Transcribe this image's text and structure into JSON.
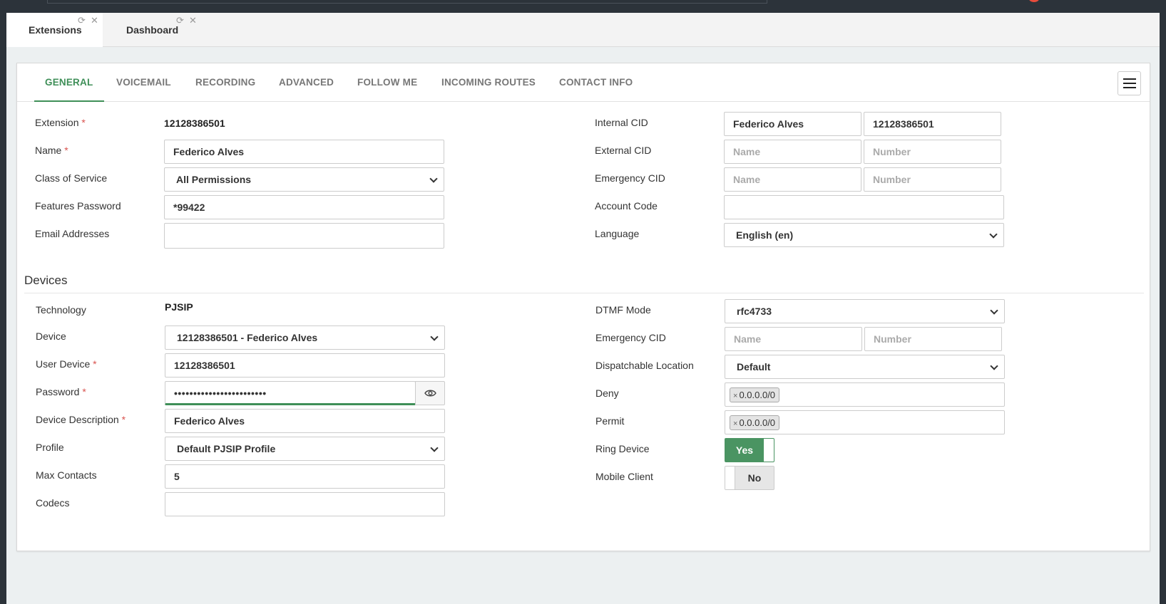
{
  "page_tabs": [
    {
      "label": "Extensions"
    },
    {
      "label": "Dashboard"
    }
  ],
  "sub_tabs": [
    "GENERAL",
    "VOICEMAIL",
    "RECORDING",
    "ADVANCED",
    "FOLLOW ME",
    "INCOMING ROUTES",
    "CONTACT INFO"
  ],
  "general": {
    "extension": {
      "label": "Extension",
      "value": "12128386501"
    },
    "name": {
      "label": "Name",
      "value": "Federico Alves"
    },
    "class_of_service": {
      "label": "Class of Service",
      "value": "All Permissions"
    },
    "features_password": {
      "label": "Features Password",
      "value": "*99422"
    },
    "email_addresses": {
      "label": "Email Addresses",
      "value": ""
    },
    "internal_cid": {
      "label": "Internal CID",
      "name": "Federico Alves",
      "number": "12128386501"
    },
    "external_cid": {
      "label": "External CID",
      "name_placeholder": "Name",
      "number_placeholder": "Number"
    },
    "emergency_cid": {
      "label": "Emergency CID",
      "name_placeholder": "Name",
      "number_placeholder": "Number"
    },
    "account_code": {
      "label": "Account Code",
      "value": ""
    },
    "language": {
      "label": "Language",
      "value": "English (en)"
    }
  },
  "devices": {
    "title": "Devices",
    "technology": {
      "label": "Technology",
      "value": "PJSIP"
    },
    "device": {
      "label": "Device",
      "value": "12128386501 - Federico Alves"
    },
    "user_device": {
      "label": "User Device",
      "value": "12128386501"
    },
    "password": {
      "label": "Password",
      "value": "••••••••••••••••••••••••"
    },
    "device_description": {
      "label": "Device Description",
      "value": "Federico Alves"
    },
    "profile": {
      "label": "Profile",
      "value": "Default PJSIP Profile"
    },
    "max_contacts": {
      "label": "Max Contacts",
      "value": "5"
    },
    "codecs": {
      "label": "Codecs",
      "value": ""
    },
    "dtmf_mode": {
      "label": "DTMF Mode",
      "value": "rfc4733"
    },
    "emergency_cid": {
      "label": "Emergency CID",
      "name_placeholder": "Name",
      "number_placeholder": "Number"
    },
    "dispatchable_location": {
      "label": "Dispatchable Location",
      "value": "Default"
    },
    "deny": {
      "label": "Deny",
      "tag": "0.0.0.0/0"
    },
    "permit": {
      "label": "Permit",
      "tag": "0.0.0.0/0"
    },
    "ring_device": {
      "label": "Ring Device",
      "value": "Yes"
    },
    "mobile_client": {
      "label": "Mobile Client",
      "value": "No"
    }
  },
  "required_mark": "*",
  "tag_remove": "×",
  "colors": {
    "accent": "#3f8f58",
    "required": "#d9534f",
    "frame": "#2c333a"
  }
}
